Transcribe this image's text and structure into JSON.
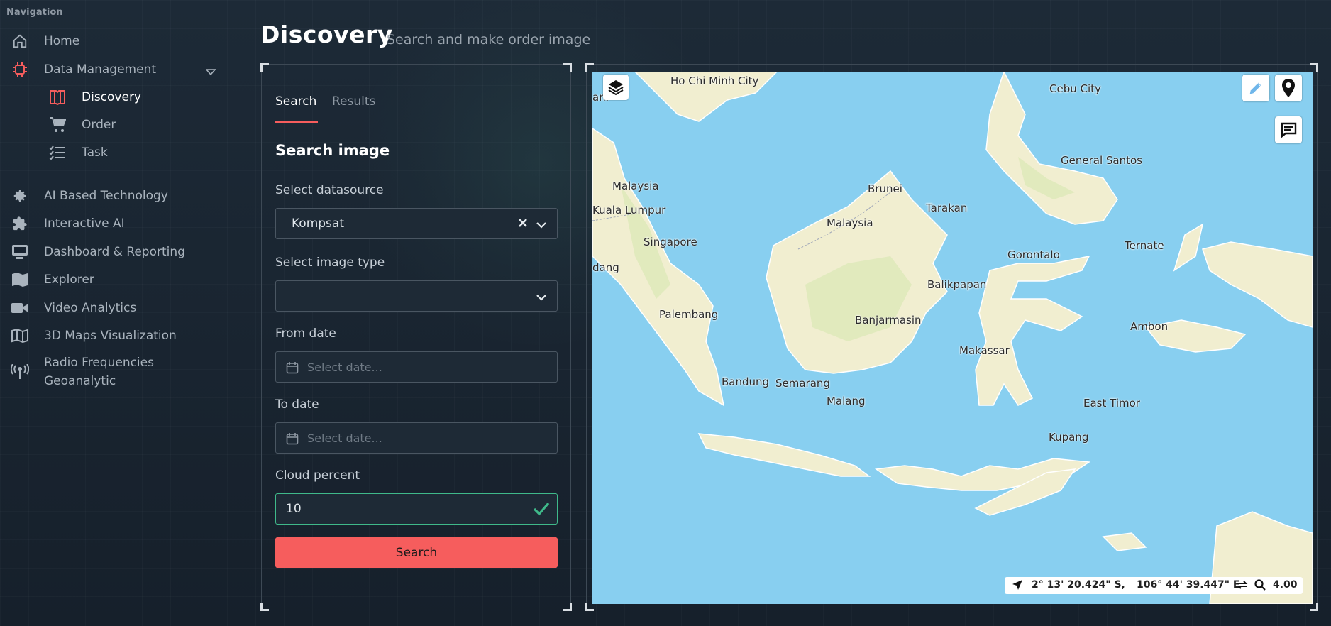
{
  "nav": {
    "title": "Navigation",
    "items": [
      {
        "label": "Home",
        "icon": "home-icon"
      },
      {
        "label": "Data Management",
        "icon": "chip-icon"
      },
      {
        "label": "AI Based Technology",
        "icon": "gear-icon"
      },
      {
        "label": "Interactive AI",
        "icon": "puzzle-icon"
      },
      {
        "label": "Dashboard & Reporting",
        "icon": "monitor-icon"
      },
      {
        "label": "Explorer",
        "icon": "map-icon"
      },
      {
        "label": "Video Analytics",
        "icon": "video-icon"
      },
      {
        "label": "3D Maps Visualization",
        "icon": "map-outline-icon"
      },
      {
        "label": "Radio Frequencies Geoanalytic",
        "icon": "antenna-icon"
      }
    ],
    "sub_items": [
      {
        "label": "Discovery",
        "icon": "book-icon"
      },
      {
        "label": "Order",
        "icon": "cart-icon"
      },
      {
        "label": "Task",
        "icon": "checklist-icon"
      }
    ]
  },
  "header": {
    "title": "Discovery",
    "subtitle": "Search and make order image"
  },
  "form": {
    "tabs": [
      "Search",
      "Results"
    ],
    "section_title": "Search image",
    "datasource_label": "Select datasource",
    "datasource_value": "Kompsat",
    "image_type_label": "Select image type",
    "image_type_value": "",
    "from_date_label": "From date",
    "from_date_placeholder": "Select date...",
    "to_date_label": "To date",
    "to_date_placeholder": "Select date...",
    "cloud_label": "Cloud percent",
    "cloud_value": "10",
    "search_button": "Search"
  },
  "map": {
    "cities": [
      "Ho Chi Minh City",
      "Cebu City",
      "General Santos",
      "Malaysia",
      "Brunei",
      "Tarakan",
      "Kuala Lumpur",
      "Malaysia",
      "Singapore",
      "Gorontalo",
      "Ternate",
      "Balikpapan",
      "Palembang",
      "Banjarmasin",
      "Ambon",
      "Makassar",
      "Bandung",
      "Semarang",
      "Malang",
      "East Timor",
      "Kupang",
      "ani",
      "dang"
    ],
    "coord_lat": "2° 13' 20.424\" S,",
    "coord_lon": "106° 44' 39.447\" E",
    "zoom": "4.00",
    "colors": {
      "water": "#88cff0",
      "land": "#f1eed0",
      "forest": "#dde8b8"
    }
  }
}
